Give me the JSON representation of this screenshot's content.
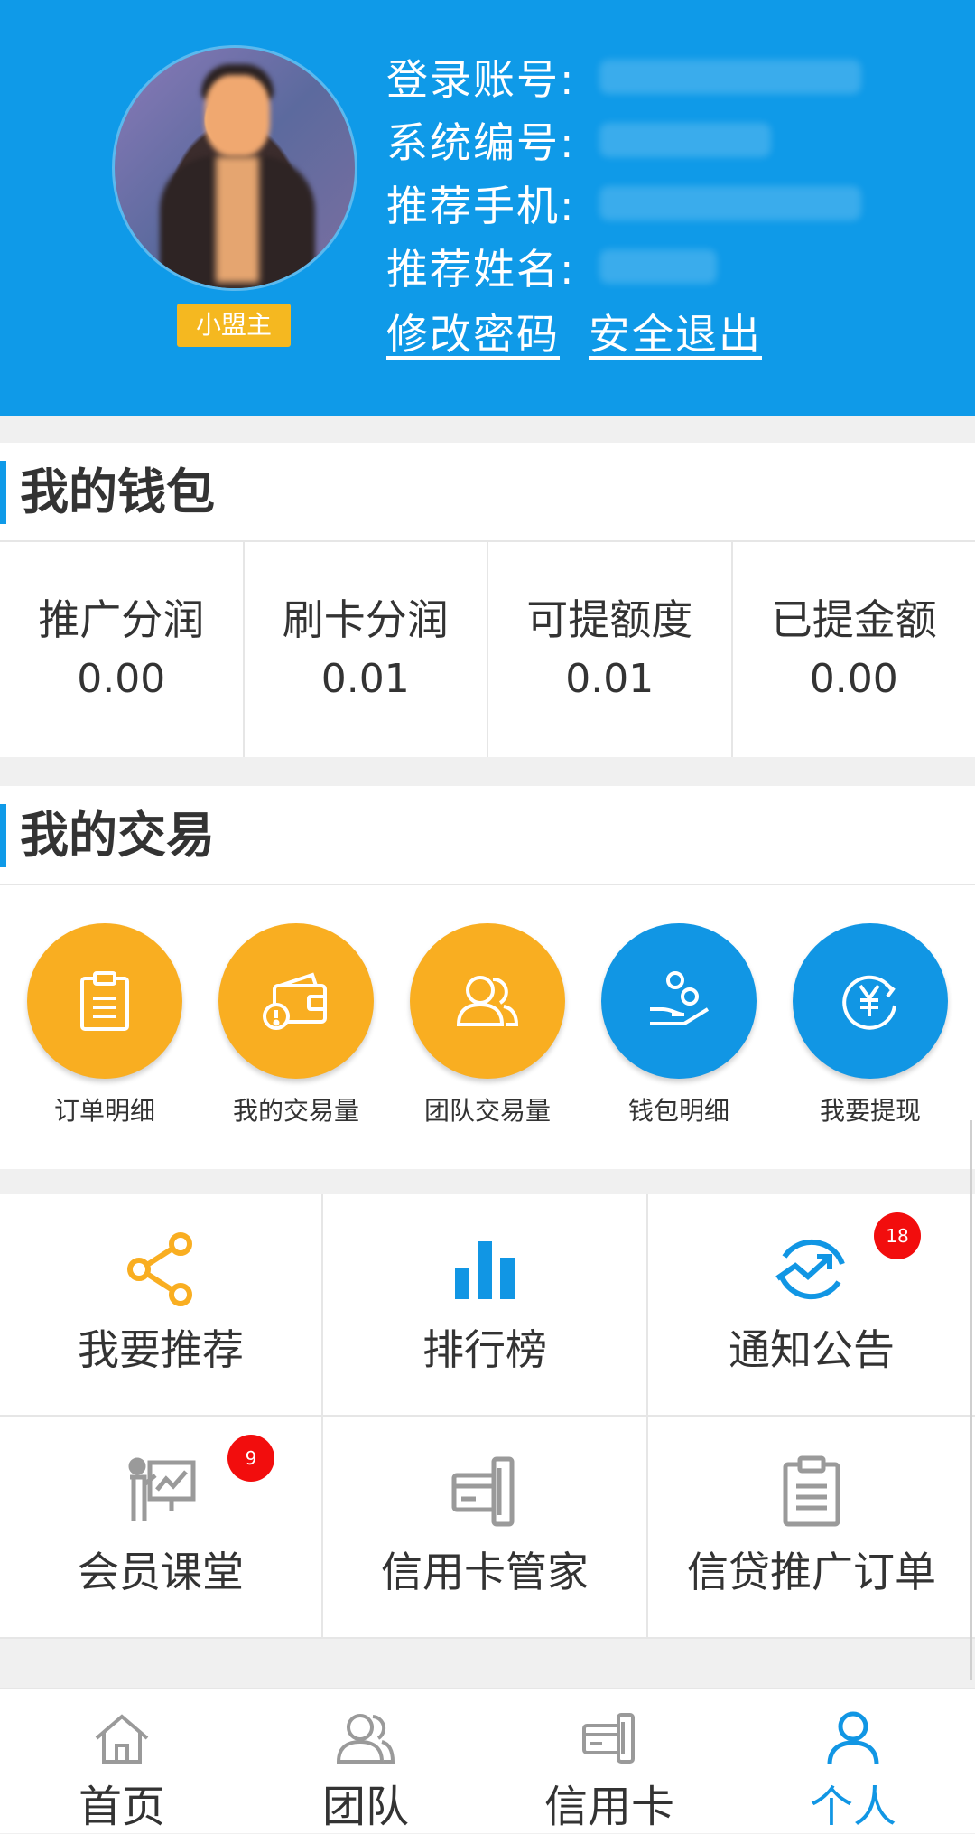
{
  "profile": {
    "level_badge": "小盟主",
    "fields": [
      {
        "label": "登录账号:",
        "value": ""
      },
      {
        "label": "系统编号:",
        "value": ""
      },
      {
        "label": "推荐手机:",
        "value": ""
      },
      {
        "label": "推荐姓名:",
        "value": ""
      }
    ],
    "change_password": "修改密码",
    "logout": "安全退出"
  },
  "wallet": {
    "title": "我的钱包",
    "items": [
      {
        "label": "推广分润",
        "value": "0.00"
      },
      {
        "label": "刷卡分润",
        "value": "0.01"
      },
      {
        "label": "可提额度",
        "value": "0.01"
      },
      {
        "label": "已提金额",
        "value": "0.00"
      }
    ]
  },
  "trade": {
    "title": "我的交易",
    "items": [
      {
        "label": "订单明细",
        "icon": "clipboard-icon",
        "color": "#f9ae21"
      },
      {
        "label": "我的交易量",
        "icon": "wallet-alert-icon",
        "color": "#f9ae21"
      },
      {
        "label": "团队交易量",
        "icon": "team-icon",
        "color": "#f9ae21"
      },
      {
        "label": "钱包明细",
        "icon": "hand-coins-icon",
        "color": "#1196e4"
      },
      {
        "label": "我要提现",
        "icon": "yuan-refresh-icon",
        "color": "#1196e4"
      }
    ]
  },
  "grid": {
    "items": [
      {
        "label": "我要推荐",
        "icon": "share-icon",
        "badge": ""
      },
      {
        "label": "排行榜",
        "icon": "bar-chart-icon",
        "badge": ""
      },
      {
        "label": "通知公告",
        "icon": "trend-up-icon",
        "badge": "18"
      },
      {
        "label": "会员课堂",
        "icon": "presentation-icon",
        "badge": "9"
      },
      {
        "label": "信用卡管家",
        "icon": "credit-card-icon",
        "badge": ""
      },
      {
        "label": "信贷推广订单",
        "icon": "clipboard-icon",
        "badge": ""
      }
    ]
  },
  "nav": {
    "tabs": [
      {
        "label": "首页",
        "icon": "home-icon",
        "active": false
      },
      {
        "label": "团队",
        "icon": "team-icon",
        "active": false
      },
      {
        "label": "信用卡",
        "icon": "credit-card-icon",
        "active": false
      },
      {
        "label": "个人",
        "icon": "person-icon",
        "active": true
      }
    ]
  },
  "colors": {
    "primary": "#0f9ae8",
    "accent_orange": "#f9ae21",
    "badge_red": "#f20d0d"
  }
}
